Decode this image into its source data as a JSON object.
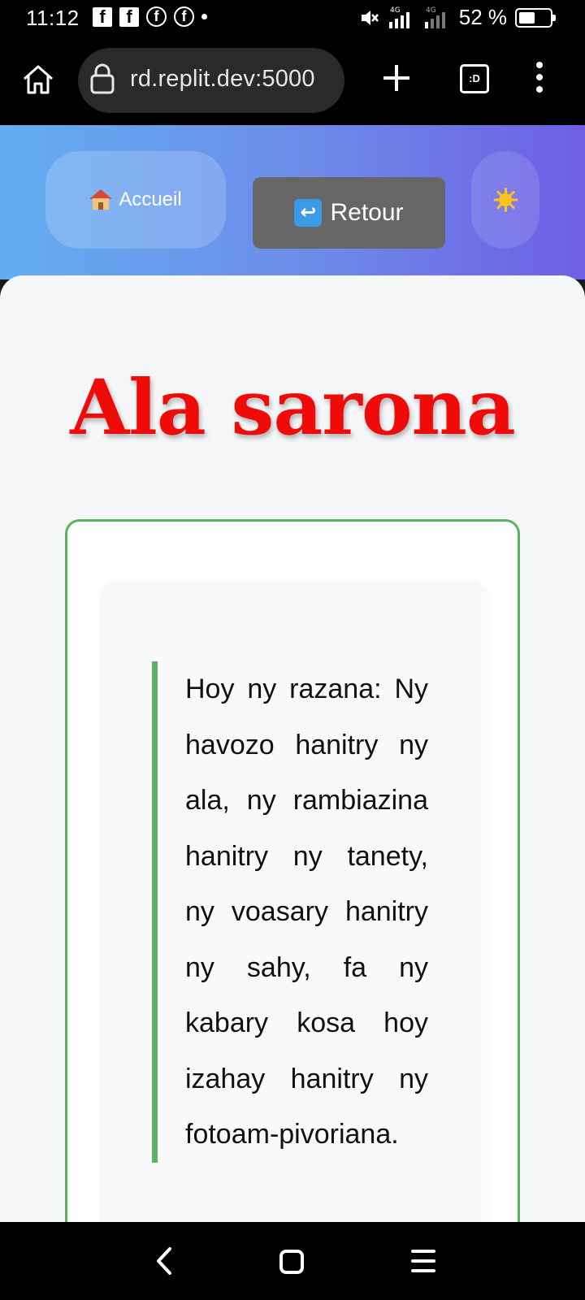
{
  "status_bar": {
    "time": "11:12",
    "fb_square_glyph": "f",
    "fb_circle_glyph": "f",
    "network_1": "4G",
    "network_2": "4G",
    "battery_text": "52 %",
    "battery_level": 0.52
  },
  "browser": {
    "url": "rd.replit.dev:5000",
    "tabs_label": ":D"
  },
  "header": {
    "home_label": "Accueil",
    "back_label": "Retour",
    "back_icon_glyph": "↩"
  },
  "main": {
    "title": "Ala sarona",
    "quote": "Hoy ny razana: Ny havozo hanitry ny ala, ny rambiazina hanitry ny tanety, ny voasary hanitry ny sahy, fa ny kabary kosa hoy izahay hanitry ny fotoam-pivoriana."
  },
  "colors": {
    "title_red": "#f00b0b",
    "accent_green": "#5cb15f",
    "gradient_start": "#63aef2",
    "gradient_end": "#6e5ee5"
  }
}
